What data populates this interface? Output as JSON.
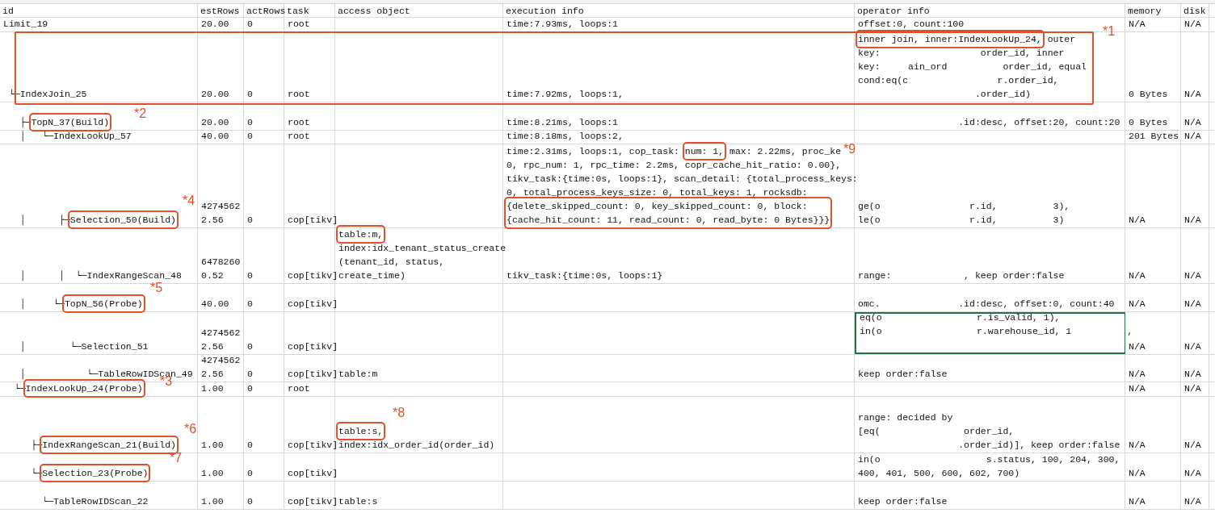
{
  "columns": [
    "id",
    "estRows",
    "actRows",
    "task",
    "access object",
    "execution info",
    "operator info",
    "memory",
    "disk"
  ],
  "rows": [
    {
      "cells": [
        "Limit_19",
        "20.00",
        "0",
        "root",
        "",
        "time:7.93ms, loops:1",
        "offset:0, count:100",
        "N/A",
        "N/A"
      ],
      "selected": false
    },
    {
      "cells": [
        " └─IndexJoin_25",
        "20.00",
        "0",
        "root",
        "",
        "time:7.92ms, loops:1,",
        [
          {
            "text": "inner join, inner:IndexLookUp_24,",
            "boxed": true
          },
          {
            "text": " outer\nkey:                  order_id, inner\nkey:     ain_ord          order_id, equal\ncond:eq(c                r.order_id,\n                     .order_id)",
            "boxed": false
          }
        ],
        "0 Bytes",
        "N/A"
      ],
      "selected": false
    },
    {
      "cells": [
        [
          {
            "text": "   ├─",
            "boxed": false
          },
          {
            "text": "TopN_37(Build)",
            "boxed": true
          }
        ],
        "20.00",
        "0",
        "root",
        "",
        "time:8.21ms, loops:1",
        "                  .id:desc, offset:20, count:20",
        "0 Bytes",
        "N/A"
      ],
      "selected": false
    },
    {
      "cells": [
        "   │   └─IndexLookUp_57",
        "40.00",
        "0",
        "root",
        "",
        "time:8.18ms, loops:2,",
        "",
        "201 Bytes",
        "N/A"
      ],
      "selected": false
    },
    {
      "cells": [
        [
          {
            "text": "   │      ├─",
            "boxed": false
          },
          {
            "text": "Selection_50(Build)",
            "boxed": true
          }
        ],
        "4274562\n2.56",
        "0",
        "cop[tikv]",
        "",
        [
          {
            "text": "time:2.31ms, loops:1, cop_task: ",
            "boxed": false
          },
          {
            "text": "num: 1,",
            "boxed": true
          },
          {
            "text": " max: 2.22ms, proc_ke\n0, rpc_num: 1, rpc_time: 2.2ms, copr_cache_hit_ratio: 0.00},\ntikv_task:{time:0s, loops:1}, scan_detail: {total_process_keys:\n0, total_process_keys_size: 0, total_keys: 1, rocksdb:\n",
            "boxed": false
          },
          {
            "text": "{delete_skipped_count: 0, key_skipped_count: 0, block:\n{cache_hit_count: 11, read_count: 0, read_byte: 0 Bytes}}}",
            "boxed": true
          }
        ],
        "ge(o                r.id,          3),\nle(o                r.id,          3)",
        "N/A",
        "N/A"
      ],
      "selected": false
    },
    {
      "cells": [
        "   │      │  └─IndexRangeScan_48",
        "6478260\n0.52",
        "0",
        "cop[tikv]",
        [
          {
            "text": "table:m,",
            "boxed": true
          },
          {
            "text": "\nindex:idx_tenant_status_create\n(tenant_id, status,\ncreate_time)",
            "boxed": false
          }
        ],
        "tikv_task:{time:0s, loops:1}",
        "range:             , keep order:false",
        "N/A",
        "N/A"
      ],
      "selected": false
    },
    {
      "cells": [
        [
          {
            "text": "   │     └─",
            "boxed": false
          },
          {
            "text": "TopN_56(Probe)",
            "boxed": true
          }
        ],
        "40.00",
        "0",
        "cop[tikv]",
        "",
        "",
        "omc.              .id:desc, offset:0, count:40",
        "N/A",
        "N/A"
      ],
      "selected": false
    },
    {
      "cells": [
        "   │        └─Selection_51",
        "4274562\n2.56",
        "0",
        "cop[tikv]",
        "",
        "",
        "eq(o                 r.is_valid, 1),\nin(o                 r.warehouse_id, 1          ,\n ",
        "N/A",
        "N/A"
      ],
      "selected": true
    },
    {
      "cells": [
        "   │           └─TableRowIDScan_49",
        "4274562\n2.56",
        "0",
        "cop[tikv]",
        "table:m",
        "",
        "keep order:false",
        "N/A",
        "N/A"
      ],
      "selected": false
    },
    {
      "cells": [
        [
          {
            "text": "  └─",
            "boxed": false
          },
          {
            "text": "IndexLookUp_24(Probe)",
            "boxed": true
          }
        ],
        "1.00",
        "0",
        "root",
        "",
        "",
        "",
        "N/A",
        "N/A"
      ],
      "selected": false
    },
    {
      "cells": [
        [
          {
            "text": "     ├─",
            "boxed": false
          },
          {
            "text": "IndexRangeScan_21(Build)",
            "boxed": true
          }
        ],
        "1.00",
        "0",
        "cop[tikv]",
        [
          {
            "text": "table:s,",
            "boxed": true
          },
          {
            "text": "\nindex:idx_order_id(order_id)",
            "boxed": false
          }
        ],
        "",
        "range: decided by\n[eq(               order_id,\n                  .order_id)], keep order:false",
        "N/A",
        "N/A"
      ],
      "selected": false
    },
    {
      "cells": [
        [
          {
            "text": "     └─",
            "boxed": false
          },
          {
            "text": "Selection_23(Probe)",
            "boxed": true
          }
        ],
        "1.00",
        "0",
        "cop[tikv]",
        "",
        "",
        "in(o                   s.status, 100, 204, 300,\n400, 401, 500, 600, 602, 700)",
        "N/A",
        "N/A"
      ],
      "selected": false
    },
    {
      "cells": [
        "       └─TableRowIDScan_22",
        "1.00",
        "0",
        "cop[tikv]",
        "table:s",
        "",
        "keep order:false",
        "N/A",
        "N/A"
      ],
      "selected": false
    }
  ],
  "annotations": [
    {
      "label": "*1"
    },
    {
      "label": "*2"
    },
    {
      "label": "*4"
    },
    {
      "label": "*9"
    },
    {
      "label": "*5"
    },
    {
      "label": "*3"
    },
    {
      "label": "*6"
    },
    {
      "label": "*8"
    },
    {
      "label": "*7"
    }
  ]
}
